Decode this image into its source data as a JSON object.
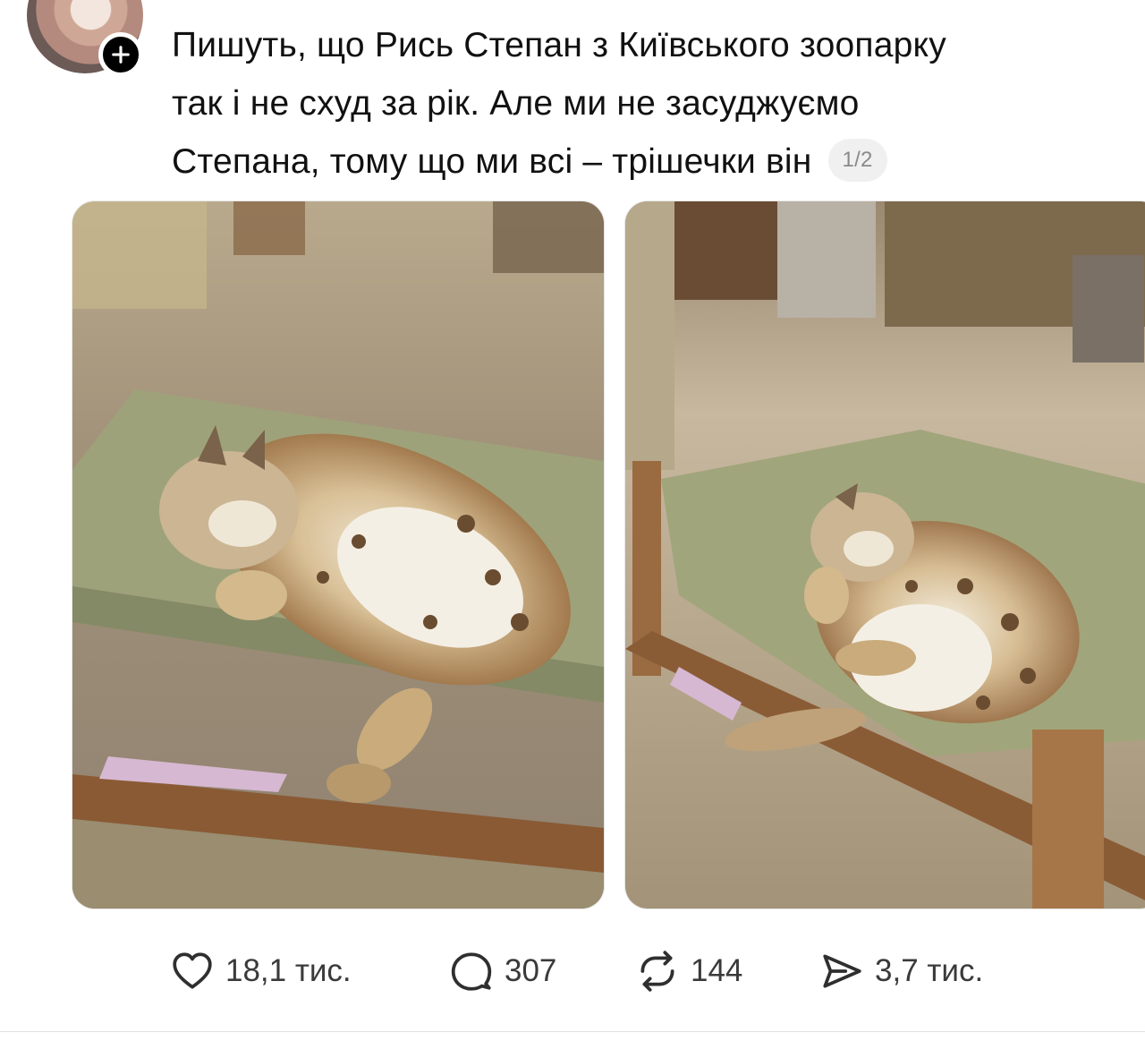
{
  "post": {
    "text_lines": [
      "Пишуть, що Рись Степан з Київського зоопарку",
      "так і не схуд за рік. Але ми не засуджуємо",
      "Степана, тому що ми всі – трішечки він"
    ],
    "page_counter": "1/2"
  },
  "avatar": {
    "follow_icon": "plus-icon"
  },
  "media": [
    {
      "name": "lynx-photo-1",
      "icon": "photo"
    },
    {
      "name": "lynx-photo-2",
      "icon": "photo"
    }
  ],
  "actions": {
    "likes": "18,1 тис.",
    "comments": "307",
    "reposts": "144",
    "shares": "3,7 тис."
  },
  "colors": {
    "text": "#111111",
    "muted": "#8a8a8a",
    "icon": "#3a3a3a"
  }
}
